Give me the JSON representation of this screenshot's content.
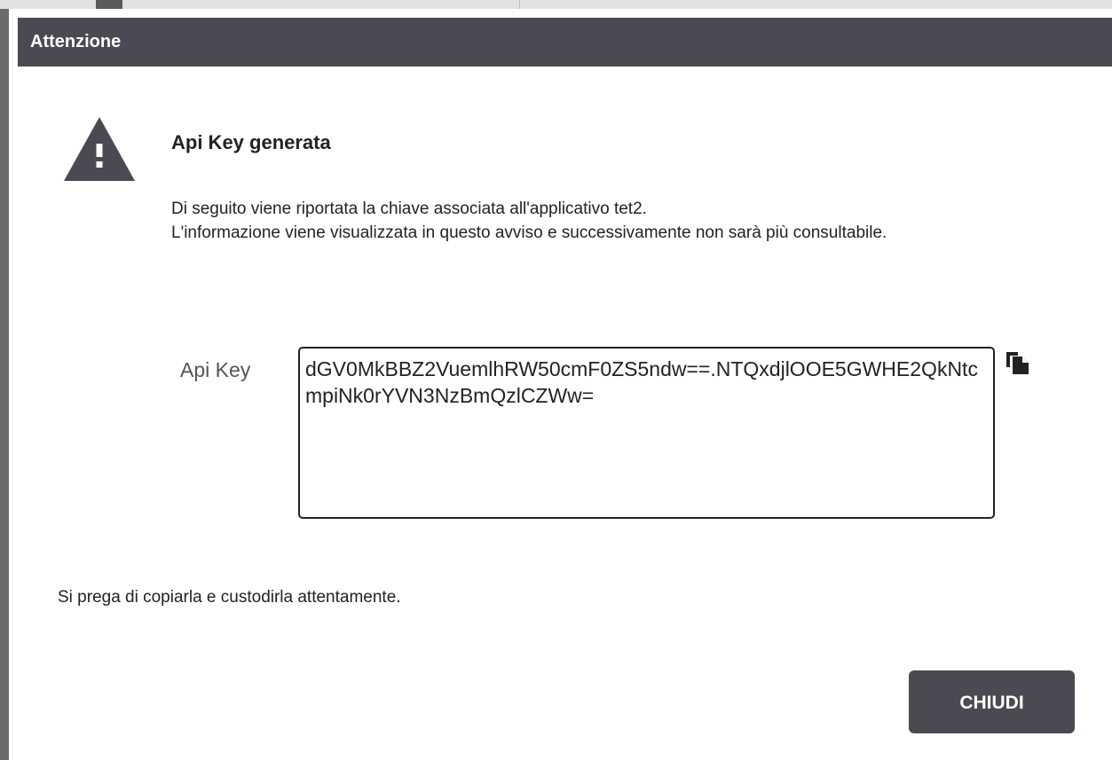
{
  "dialog": {
    "title": "Attenzione",
    "message_title": "Api Key generata",
    "message_lines": [
      "Di seguito viene riportata la chiave associata all'applicativo tet2.",
      "L'informazione viene visualizzata in questo avviso e successivamente non sarà più consultabile."
    ],
    "api_key_label": "Api Key",
    "api_key_value": "dGV0MkBBZ2VuemlhRW50cmF0ZS5ndw==.NTQxdjlOOE5GWHE2QkNtcmpiNk0rYVN3NzBmQzlCZWw=",
    "footer_note": "Si prega di copiarla e custodirla attentamente.",
    "close_label": "CHIUDI"
  },
  "icons": {
    "warning": "warning-triangle-icon",
    "copy": "copy-icon"
  },
  "colors": {
    "header_bg": "#4a4b52",
    "button_bg": "#4a4b52",
    "text": "#222222"
  }
}
